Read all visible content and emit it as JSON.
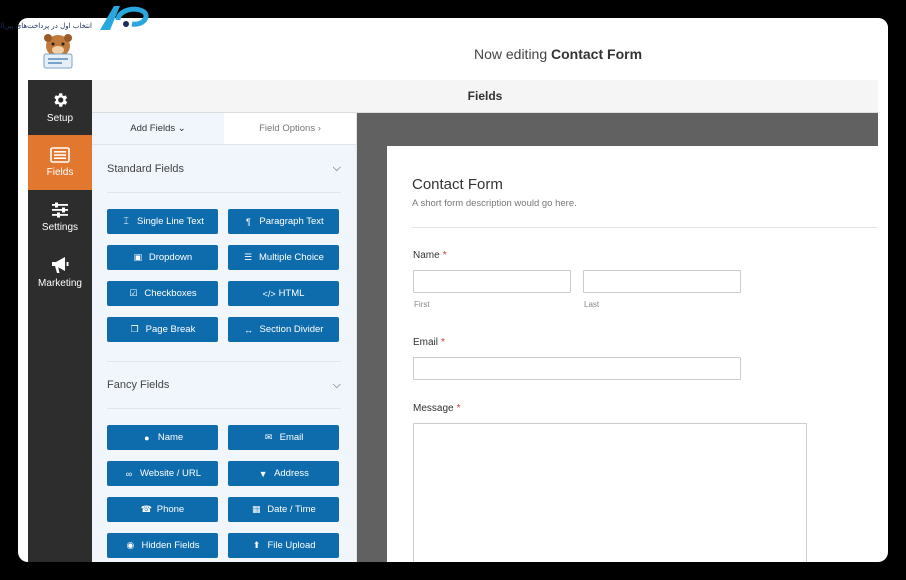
{
  "watermark": {
    "text": "انتخاب اول در پرداخت‌های بین‌المللی"
  },
  "header": {
    "prefix": "Now editing",
    "form_name": "Contact Form"
  },
  "sidebar": {
    "items": [
      {
        "label": "Setup",
        "icon": "gear-icon",
        "active": false
      },
      {
        "label": "Fields",
        "icon": "list-icon",
        "active": true
      },
      {
        "label": "Settings",
        "icon": "sliders-icon",
        "active": false
      },
      {
        "label": "Marketing",
        "icon": "megaphone-icon",
        "active": false
      }
    ]
  },
  "panel_title": "Fields",
  "tabs": {
    "add_fields": "Add Fields",
    "field_options": "Field Options"
  },
  "standard": {
    "title": "Standard Fields",
    "buttons": [
      "Single Line Text",
      "Paragraph Text",
      "Dropdown",
      "Multiple Choice",
      "Checkboxes",
      "HTML",
      "Page Break",
      "Section Divider"
    ]
  },
  "fancy": {
    "title": "Fancy Fields",
    "buttons": [
      "Name",
      "Email",
      "Website / URL",
      "Address",
      "Phone",
      "Date / Time",
      "Hidden Fields",
      "File Upload"
    ]
  },
  "form": {
    "title": "Contact Form",
    "description": "A short form description would go here.",
    "name_label": "Name",
    "first_label": "First",
    "last_label": "Last",
    "email_label": "Email",
    "message_label": "Message",
    "required_mark": "*"
  },
  "colors": {
    "accent": "#e27730",
    "button": "#0e6cad",
    "sidebar": "#2d2d2d"
  }
}
